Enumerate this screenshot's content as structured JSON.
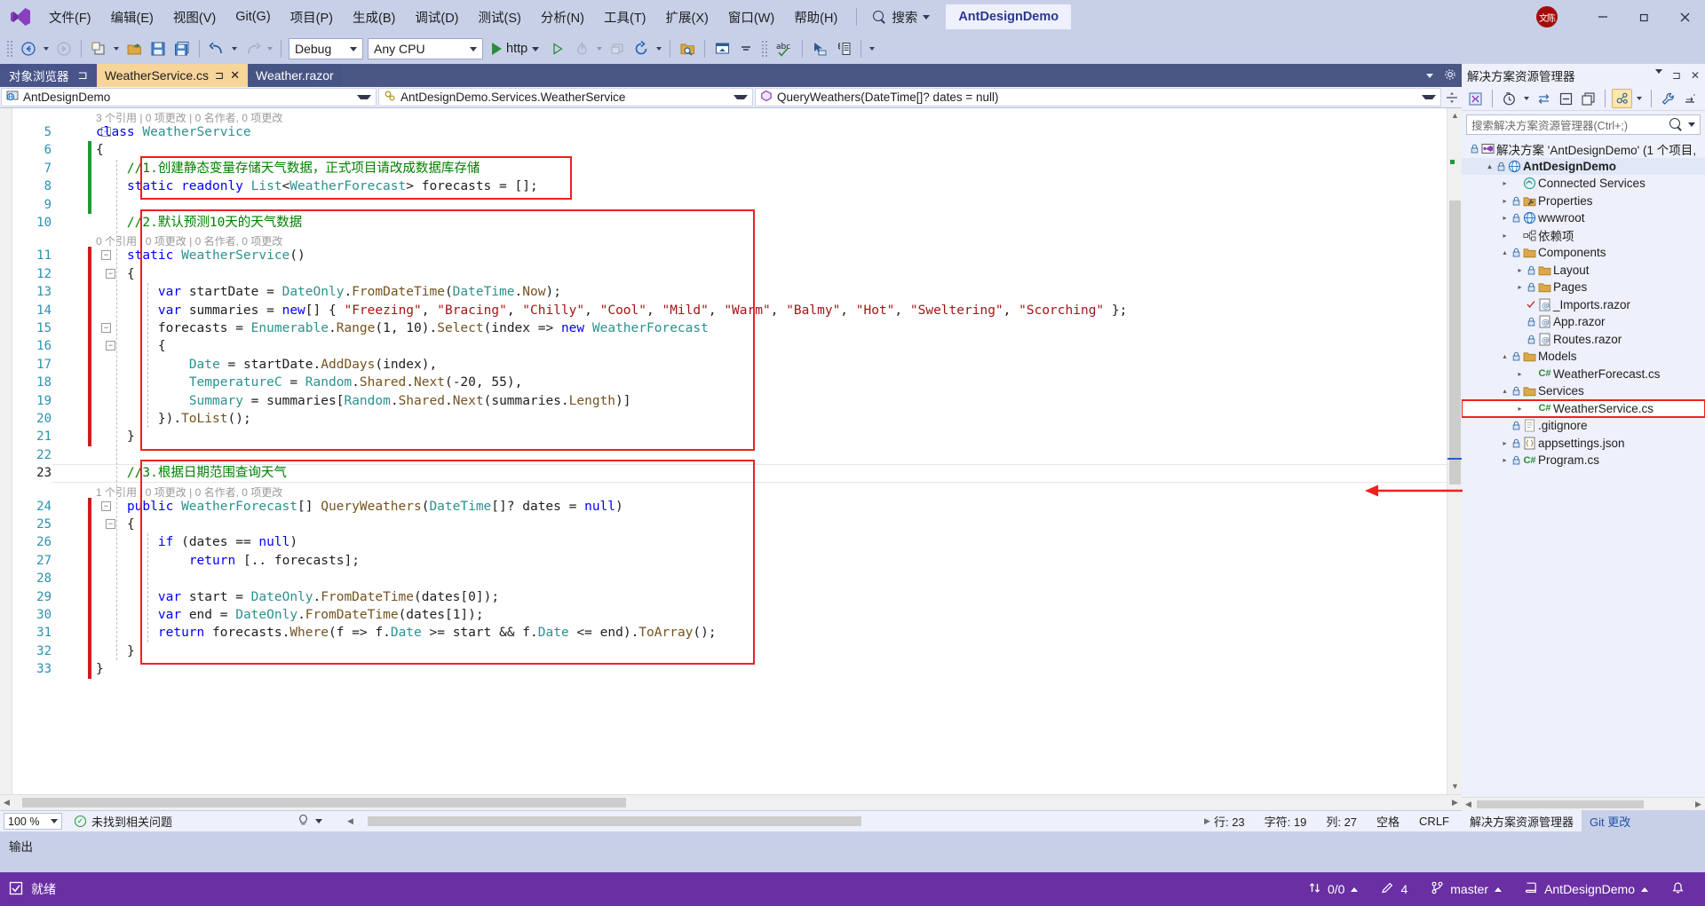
{
  "titlebar": {
    "logo_name": "visual-studio-logo",
    "menus": [
      "文件(F)",
      "编辑(E)",
      "视图(V)",
      "Git(G)",
      "项目(P)",
      "生成(B)",
      "调试(D)",
      "测试(S)",
      "分析(N)",
      "工具(T)",
      "扩展(X)",
      "窗口(W)",
      "帮助(H)"
    ],
    "search_label": "搜索",
    "solution_name": "AntDesignDemo",
    "avatar_text": "文陈",
    "minimize": "—",
    "maximize": "❐",
    "close": "✕"
  },
  "toolbar": {
    "back_label": "←",
    "forward_label": "→",
    "config": "Debug",
    "platform": "Any CPU",
    "run_label": "http",
    "items": [
      "navigate-back-icon",
      "navigate-forward-icon",
      "new-project-icon",
      "open-file-icon",
      "save-icon",
      "save-all-icon",
      "undo-icon",
      "redo-icon"
    ]
  },
  "tabs": {
    "dock_label": "对象浏览器",
    "open": [
      {
        "label": "WeatherService.cs",
        "active": true
      },
      {
        "label": "Weather.razor",
        "active": false
      }
    ]
  },
  "navbar": {
    "project": "AntDesignDemo",
    "type": "AntDesignDemo.Services.WeatherService",
    "member": "QueryWeathers(DateTime[]? dates = null)"
  },
  "editor": {
    "codelens_class": "3 个引用 | 0 项更改 | 0 名作者, 0 项更改",
    "codelens_ctor": "0 个引用 | 0 项更改 | 0 名作者, 0 项更改",
    "codelens_query": "1 个引用 | 0 项更改 | 0 名作者, 0 项更改",
    "lines": [
      {
        "n": "5",
        "text": "class WeatherService",
        "fold": "−"
      },
      {
        "n": "6",
        "text": "{"
      },
      {
        "n": "7",
        "text": "    //1.创建静态变量存储天气数据，正式项目请改成数据库存储"
      },
      {
        "n": "8",
        "text": "    static readonly List<WeatherForecast> forecasts = [];"
      },
      {
        "n": "9",
        "text": ""
      },
      {
        "n": "10",
        "text": "    //2.默认预测10天的天气数据"
      },
      {
        "n": "11",
        "text": "    static WeatherService()",
        "fold": "−"
      },
      {
        "n": "12",
        "text": "    {"
      },
      {
        "n": "13",
        "text": "        var startDate = DateOnly.FromDateTime(DateTime.Now);"
      },
      {
        "n": "14",
        "text": "        var summaries = new[] { \"Freezing\", \"Bracing\", \"Chilly\", \"Cool\", \"Mild\", \"Warm\", \"Balmy\", \"Hot\", \"Sweltering\", \"Scorching\" };"
      },
      {
        "n": "15",
        "text": "        forecasts = Enumerable.Range(1, 10).Select(index => new WeatherForecast",
        "fold": "−"
      },
      {
        "n": "16",
        "text": "        {"
      },
      {
        "n": "17",
        "text": "            Date = startDate.AddDays(index),"
      },
      {
        "n": "18",
        "text": "            TemperatureC = Random.Shared.Next(-20, 55),"
      },
      {
        "n": "19",
        "text": "            Summary = summaries[Random.Shared.Next(summaries.Length)]"
      },
      {
        "n": "20",
        "text": "        }).ToList();"
      },
      {
        "n": "21",
        "text": "    }"
      },
      {
        "n": "22",
        "text": ""
      },
      {
        "n": "23",
        "text": "    //3.根据日期范围查询天气"
      },
      {
        "n": "24",
        "text": "    public WeatherForecast[] QueryWeathers(DateTime[]? dates = null)",
        "fold": "−"
      },
      {
        "n": "25",
        "text": "    {"
      },
      {
        "n": "26",
        "text": "        if (dates == null)"
      },
      {
        "n": "27",
        "text": "            return [.. forecasts];"
      },
      {
        "n": "28",
        "text": ""
      },
      {
        "n": "29",
        "text": "        var start = DateOnly.FromDateTime(dates[0]);"
      },
      {
        "n": "30",
        "text": "        var end = DateOnly.FromDateTime(dates[1]);"
      },
      {
        "n": "31",
        "text": "        return forecasts.Where(f => f.Date >= start && f.Date <= end).ToArray();"
      },
      {
        "n": "32",
        "text": "    }"
      },
      {
        "n": "33",
        "text": "}"
      }
    ],
    "annotation_color": "#ef2020"
  },
  "editor_status": {
    "zoom": "100 %",
    "issues": "未找到相关问题",
    "line": "行: 23",
    "chars": "字符: 19",
    "col": "列: 27",
    "spaces": "空格",
    "eol": "CRLF"
  },
  "solution_explorer": {
    "title": "解决方案资源管理器",
    "search_placeholder": "搜索解决方案资源管理器(Ctrl+;)",
    "root": "解决方案 'AntDesignDemo' (1 个项目,",
    "tree": [
      {
        "label": "AntDesignDemo",
        "depth": 1,
        "twisty": "▴",
        "icon": "web-project-icon",
        "bold": true,
        "lock": true
      },
      {
        "label": "Connected Services",
        "depth": 2,
        "twisty": "▸",
        "icon": "connected-services-icon",
        "lock": false
      },
      {
        "label": "Properties",
        "depth": 2,
        "twisty": "▸",
        "icon": "properties-folder-icon",
        "lock": true
      },
      {
        "label": "wwwroot",
        "depth": 2,
        "twisty": "▸",
        "icon": "wwwroot-icon",
        "lock": true
      },
      {
        "label": "依赖项",
        "depth": 2,
        "twisty": "▸",
        "icon": "dependencies-icon",
        "lock": false
      },
      {
        "label": "Components",
        "depth": 2,
        "twisty": "▴",
        "icon": "folder-icon",
        "lock": true
      },
      {
        "label": "Layout",
        "depth": 3,
        "twisty": "▸",
        "icon": "folder-icon",
        "lock": true
      },
      {
        "label": "Pages",
        "depth": 3,
        "twisty": "▸",
        "icon": "folder-icon",
        "lock": true
      },
      {
        "label": "_Imports.razor",
        "depth": 3,
        "twisty": "",
        "icon": "razor-icon",
        "check": true
      },
      {
        "label": "App.razor",
        "depth": 3,
        "twisty": "",
        "icon": "razor-icon",
        "lock": true
      },
      {
        "label": "Routes.razor",
        "depth": 3,
        "twisty": "",
        "icon": "razor-icon",
        "lock": true
      },
      {
        "label": "Models",
        "depth": 2,
        "twisty": "▴",
        "icon": "folder-icon",
        "lock": true
      },
      {
        "label": "WeatherForecast.cs",
        "depth": 3,
        "twisty": "▸",
        "icon": "csharp-icon",
        "lock": false
      },
      {
        "label": "Services",
        "depth": 2,
        "twisty": "▴",
        "icon": "folder-icon",
        "lock": true
      },
      {
        "label": "WeatherService.cs",
        "depth": 3,
        "twisty": "▸",
        "icon": "csharp-icon",
        "highlight": true
      },
      {
        "label": ".gitignore",
        "depth": 2,
        "twisty": "",
        "icon": "file-icon",
        "lock": true
      },
      {
        "label": "appsettings.json",
        "depth": 2,
        "twisty": "▸",
        "icon": "json-icon",
        "lock": true
      },
      {
        "label": "Program.cs",
        "depth": 2,
        "twisty": "▸",
        "icon": "csharp-icon",
        "lock": true
      }
    ],
    "footer_tabs": [
      {
        "label": "解决方案资源管理器",
        "active": true
      },
      {
        "label": "Git 更改",
        "active": false
      }
    ]
  },
  "output": {
    "title": "输出"
  },
  "statusbar": {
    "ready": "就绪",
    "ready_icon": "checkbox-icon",
    "sync": "0/0",
    "sync_icon": "up-down-arrows-icon",
    "edits": "4",
    "edits_icon": "pencil-icon",
    "branch": "master",
    "branch_icon": "branch-icon",
    "repo": "AntDesignDemo",
    "repo_icon": "repo-icon",
    "notify_icon": "bell-icon",
    "accent": "#6a2fa3"
  }
}
